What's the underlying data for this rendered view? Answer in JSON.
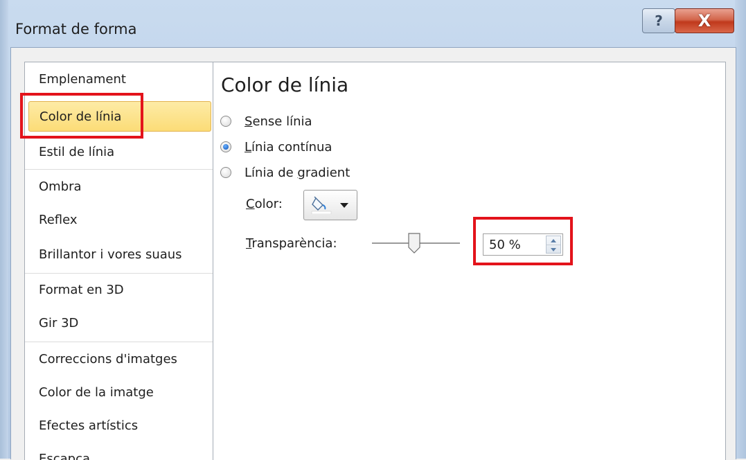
{
  "window": {
    "title": "Format de forma",
    "help_glyph": "?",
    "close_glyph": "X"
  },
  "nav": {
    "items": [
      {
        "label": "Emplenament"
      },
      {
        "label": "Color de línia",
        "selected": true
      },
      {
        "label": "Estil de línia"
      },
      {
        "label": "Ombra"
      },
      {
        "label": "Reflex"
      },
      {
        "label": "Brillantor i vores suaus"
      },
      {
        "label": "Format en 3D"
      },
      {
        "label": "Gir 3D"
      },
      {
        "label": "Correccions d'imatges"
      },
      {
        "label": "Color de la imatge"
      },
      {
        "label": "Efectes artístics"
      },
      {
        "label": "Escapça"
      }
    ]
  },
  "pane": {
    "title": "Color de línia",
    "options": [
      {
        "key": "S",
        "rest": "ense línia",
        "checked": false
      },
      {
        "key": "L",
        "rest": "ínia contínua",
        "checked": true
      },
      {
        "key_prefix": "Línia de ",
        "key": "g",
        "rest": "radient",
        "checked": false
      }
    ],
    "color_label_key": "C",
    "color_label_rest": "olor:",
    "transparency_label_key": "T",
    "transparency_label_rest": "ransparència:",
    "transparency_value": "50 %",
    "transparency_percent": 50
  },
  "colors": {
    "highlight": "#e3131b",
    "selected_bg": "#fcdc77"
  },
  "icons": {
    "color_picker": "paint-bucket-icon",
    "dropdown": "chevron-down-icon",
    "spin_up": "arrow-up-icon",
    "spin_down": "arrow-down-icon"
  }
}
